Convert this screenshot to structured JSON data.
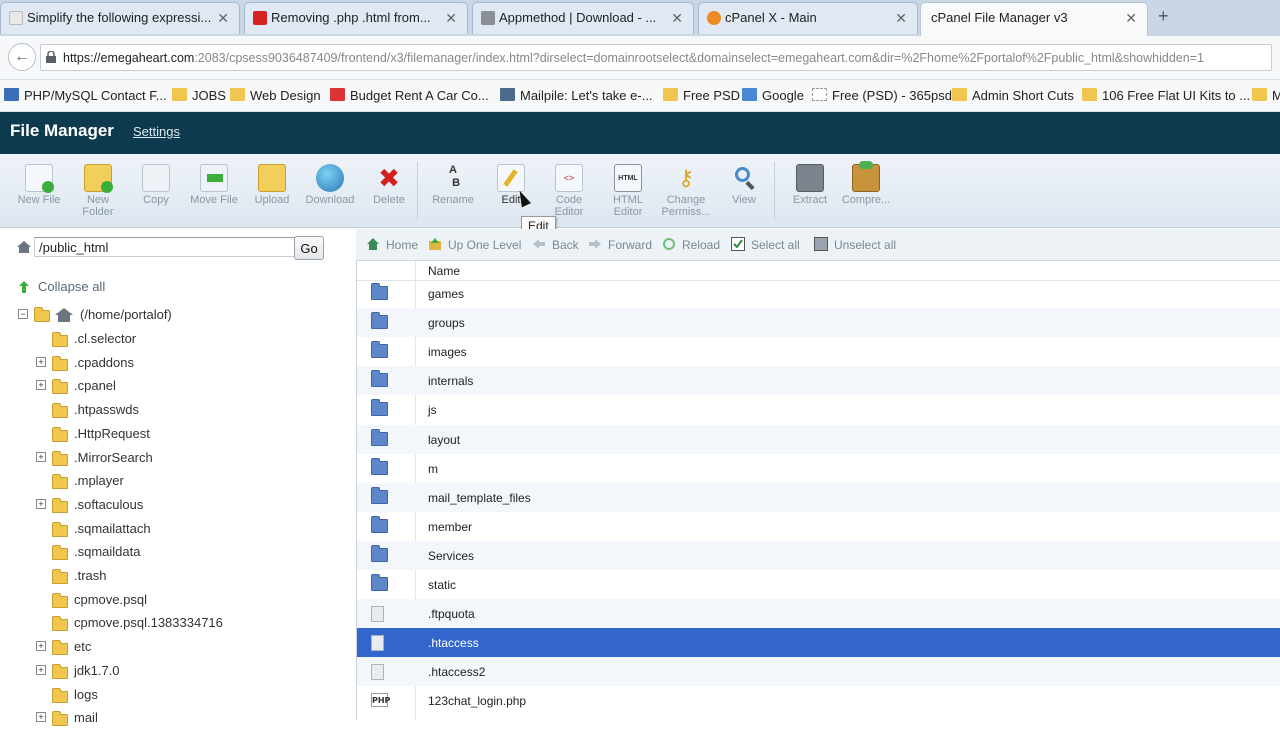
{
  "browser": {
    "tabs": [
      {
        "title": "Simplify the following expressi...",
        "active": false
      },
      {
        "title": "Removing .php .html from...",
        "active": false
      },
      {
        "title": "Appmethod | Download - ...",
        "active": false
      },
      {
        "title": "cPanel X - Main",
        "active": false
      },
      {
        "title": "cPanel File Manager v3",
        "active": true
      }
    ],
    "url_host": "https://emegaheart.com",
    "url_rest": ":2083/cpsess9036487409/frontend/x3/filemanager/index.html?dirselect=domainrootselect&domainselect=emegaheart.com&dir=%2Fhome%2Fportalof%2Fpublic_html&showhidden=1",
    "bookmarks": [
      "PHP/MySQL Contact F...",
      "JOBS",
      "Web Design",
      "Budget Rent A Car Co...",
      "Mailpile: Let's take e-...",
      "Free PSD",
      "Google",
      "Free (PSD) - 365psd",
      "Admin Short Cuts",
      "106 Free Flat UI Kits to ...",
      "M"
    ]
  },
  "header": {
    "title": "File Manager",
    "settings": "Settings"
  },
  "toolbar": {
    "tools": [
      "New File",
      "New\nFolder",
      "Copy",
      "Move File",
      "Upload",
      "Download",
      "Delete",
      "Rename",
      "Edit",
      "Code\nEditor",
      "HTML\nEditor",
      "Change\nPermiss...",
      "View",
      "Extract",
      "Compre..."
    ],
    "tooltip": "Edit"
  },
  "left": {
    "path": "/public_html",
    "go": "Go",
    "collapse_all": "Collapse all",
    "root": "(/home/portalof)",
    "tree": [
      {
        "label": ".cl.selector",
        "expandable": false
      },
      {
        "label": ".cpaddons",
        "expandable": true
      },
      {
        "label": ".cpanel",
        "expandable": true
      },
      {
        "label": ".htpasswds",
        "expandable": false
      },
      {
        "label": ".HttpRequest",
        "expandable": false
      },
      {
        "label": ".MirrorSearch",
        "expandable": true
      },
      {
        "label": ".mplayer",
        "expandable": false
      },
      {
        "label": ".softaculous",
        "expandable": true
      },
      {
        "label": ".sqmailattach",
        "expandable": false
      },
      {
        "label": ".sqmaildata",
        "expandable": false
      },
      {
        "label": ".trash",
        "expandable": false
      },
      {
        "label": "cpmove.psql",
        "expandable": false
      },
      {
        "label": "cpmove.psql.1383334716",
        "expandable": false
      },
      {
        "label": "etc",
        "expandable": true
      },
      {
        "label": "jdk1.7.0",
        "expandable": true
      },
      {
        "label": "logs",
        "expandable": false
      },
      {
        "label": "mail",
        "expandable": true
      }
    ]
  },
  "nav": {
    "home": "Home",
    "up": "Up One Level",
    "back": "Back",
    "forward": "Forward",
    "reload": "Reload",
    "select_all": "Select all",
    "unselect_all": "Unselect all"
  },
  "files": {
    "column_name": "Name",
    "rows": [
      {
        "name": "games",
        "kind": "dir"
      },
      {
        "name": "groups",
        "kind": "dir"
      },
      {
        "name": "images",
        "kind": "dir"
      },
      {
        "name": "internals",
        "kind": "dir"
      },
      {
        "name": "js",
        "kind": "dir"
      },
      {
        "name": "layout",
        "kind": "dir"
      },
      {
        "name": "m",
        "kind": "dir"
      },
      {
        "name": "mail_template_files",
        "kind": "dir"
      },
      {
        "name": "member",
        "kind": "dir"
      },
      {
        "name": "Services",
        "kind": "dir"
      },
      {
        "name": "static",
        "kind": "dir"
      },
      {
        "name": ".ftpquota",
        "kind": "file"
      },
      {
        "name": ".htaccess",
        "kind": "file",
        "selected": true
      },
      {
        "name": ".htaccess2",
        "kind": "file"
      },
      {
        "name": "123chat_login.php",
        "kind": "php"
      }
    ]
  },
  "colors": {
    "header": "#0d3b4d",
    "selection": "#3366cc"
  }
}
